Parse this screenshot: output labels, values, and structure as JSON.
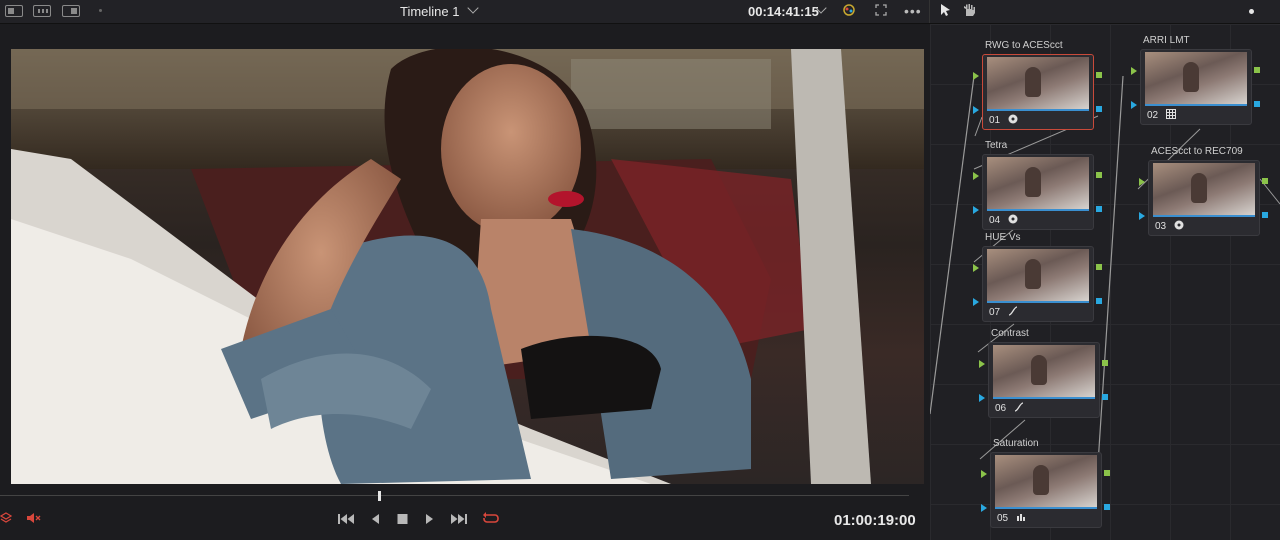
{
  "topbar": {
    "timeline_title": "Timeline 1",
    "timecode": "00:14:41:15"
  },
  "viewer": {
    "timecode": "01:00:19:00"
  },
  "nodes": [
    {
      "label": "RWG to ACEScct",
      "number": "01",
      "icon": "wheels-icon",
      "selected": true
    },
    {
      "label": "Tetra",
      "number": "04",
      "icon": "wheels-icon"
    },
    {
      "label": "HUE Vs",
      "number": "07",
      "icon": "curves-icon"
    },
    {
      "label": "Contrast",
      "number": "06",
      "icon": "curves-icon"
    },
    {
      "label": "Saturation",
      "number": "05",
      "icon": "bars-icon"
    },
    {
      "label": "ARRI LMT",
      "number": "02",
      "icon": "lut-grid-icon"
    },
    {
      "label": "ACEScct to REC709",
      "number": "03",
      "icon": "wheels-icon"
    }
  ],
  "colors": {
    "accent_red": "#d9473c",
    "node_green": "#8bc34a",
    "node_blue": "#29a8e0"
  }
}
